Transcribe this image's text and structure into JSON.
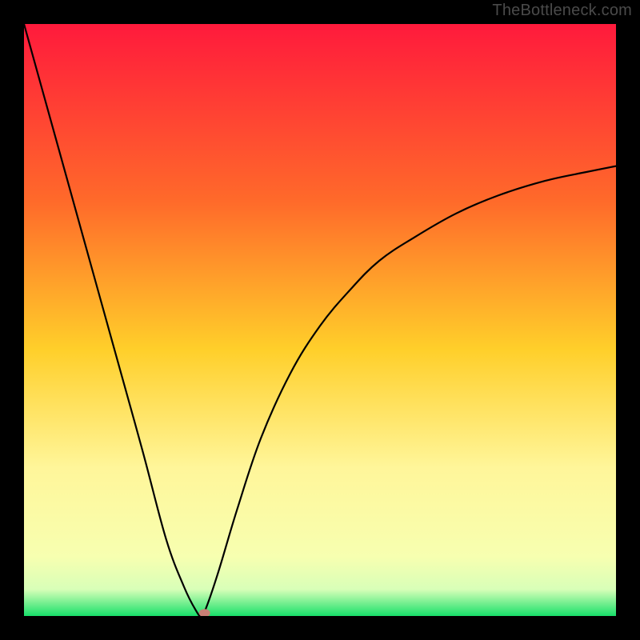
{
  "watermark": "TheBottleneck.com",
  "chart_data": {
    "type": "line",
    "title": "",
    "xlabel": "",
    "ylabel": "",
    "xlim": [
      0,
      100
    ],
    "ylim": [
      0,
      100
    ],
    "grid": false,
    "legend": false,
    "background_gradient": {
      "stops": [
        {
          "offset": 0.0,
          "color": "#ff1a3c"
        },
        {
          "offset": 0.3,
          "color": "#ff6a2a"
        },
        {
          "offset": 0.55,
          "color": "#ffcf2a"
        },
        {
          "offset": 0.75,
          "color": "#fff69a"
        },
        {
          "offset": 0.9,
          "color": "#f7ffb0"
        },
        {
          "offset": 0.955,
          "color": "#d8ffb8"
        },
        {
          "offset": 1.0,
          "color": "#18e06a"
        }
      ]
    },
    "series": [
      {
        "name": "bottleneck-curve",
        "color": "#000000",
        "x": [
          0,
          5,
          10,
          15,
          20,
          24,
          27,
          29,
          30,
          31,
          33,
          36,
          40,
          45,
          50,
          55,
          60,
          66,
          73,
          80,
          88,
          95,
          100
        ],
        "values": [
          100,
          82,
          64,
          46,
          28,
          13,
          5,
          1,
          0,
          2,
          8,
          18,
          30,
          41,
          49,
          55,
          60,
          64,
          68,
          71,
          73.5,
          75,
          76
        ]
      }
    ],
    "marker": {
      "name": "min-point",
      "x": 30.5,
      "y": 0.5,
      "color": "#c98076",
      "rx": 7,
      "ry": 5
    }
  }
}
